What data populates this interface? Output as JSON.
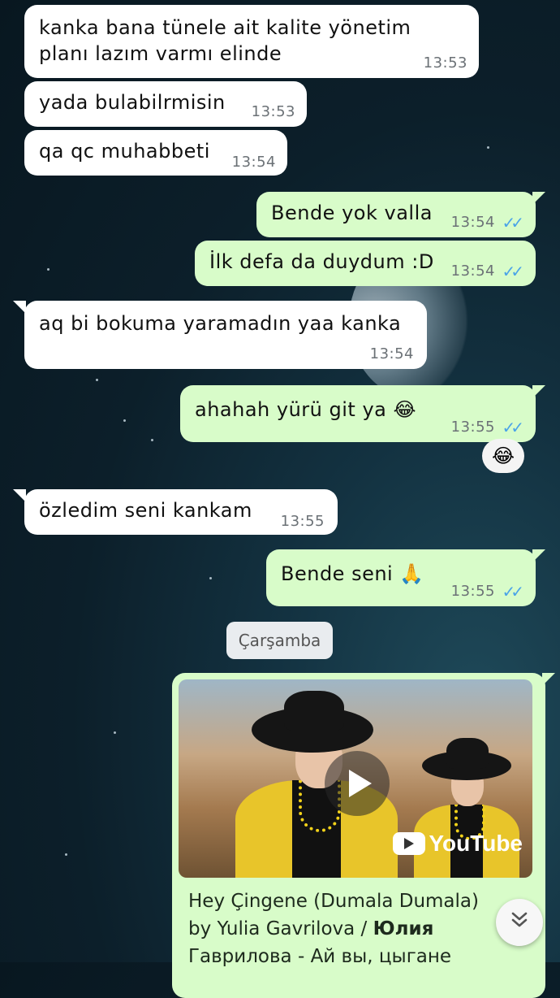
{
  "messages": [
    {
      "dir": "in",
      "text": "kanka bana tünele ait kalite yönetim planı lazım varmı elinde",
      "time": "13:53"
    },
    {
      "dir": "in",
      "text": "yada bulabilrmisin",
      "time": "13:53"
    },
    {
      "dir": "in",
      "text": "qa qc muhabbeti",
      "time": "13:54"
    },
    {
      "dir": "out",
      "text": "Bende yok valla",
      "time": "13:54",
      "ticks": "✓✓"
    },
    {
      "dir": "out",
      "text": "İlk defa da duydum :D",
      "time": "13:54",
      "ticks": "✓✓"
    },
    {
      "dir": "in",
      "text": "aq bi bokuma yaramadın yaa kanka",
      "time": "13:54"
    },
    {
      "dir": "out",
      "text": "ahahah yürü git ya 😂",
      "time": "13:55",
      "ticks": "✓✓",
      "reaction": "😂"
    },
    {
      "dir": "in",
      "text": "özledim seni kankam",
      "time": "13:55"
    },
    {
      "dir": "out",
      "text": "Bende seni 🙏",
      "time": "13:55",
      "ticks": "✓✓"
    }
  ],
  "day_separator": "Çarşamba",
  "link_preview": {
    "youtube_label": "YouTube",
    "title_line1": "Hey Çingene (Dumala Dumala)",
    "title_line2_plain": "by Yulia Gavrilova / ",
    "title_line2_bold": "Юлия",
    "title_line3": "Гаврилова - Ай вы, цыгане"
  },
  "scroll_icon": "chevron-double-down-icon",
  "colors": {
    "incoming_bubble": "#ffffff",
    "outgoing_bubble": "#d8fcc9",
    "read_ticks": "#4aa3e8"
  }
}
